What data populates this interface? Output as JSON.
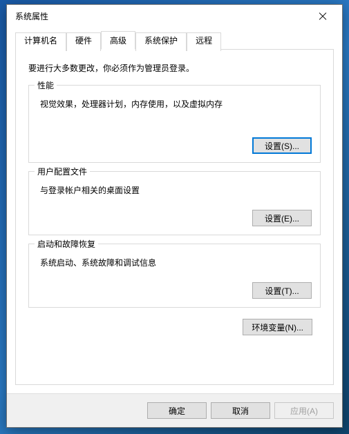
{
  "window": {
    "title": "系统属性"
  },
  "tabs": {
    "t0": "计算机名",
    "t1": "硬件",
    "t2": "高级",
    "t3": "系统保护",
    "t4": "远程"
  },
  "advanced": {
    "intro": "要进行大多数更改，你必须作为管理员登录。",
    "performance": {
      "title": "性能",
      "desc": "视觉效果，处理器计划，内存使用，以及虚拟内存",
      "button": "设置(S)..."
    },
    "userprofile": {
      "title": "用户配置文件",
      "desc": "与登录帐户相关的桌面设置",
      "button": "设置(E)..."
    },
    "startup": {
      "title": "启动和故障恢复",
      "desc": "系统启动、系统故障和调试信息",
      "button": "设置(T)..."
    },
    "env_button": "环境变量(N)..."
  },
  "footer": {
    "ok": "确定",
    "cancel": "取消",
    "apply": "应用(A)"
  }
}
